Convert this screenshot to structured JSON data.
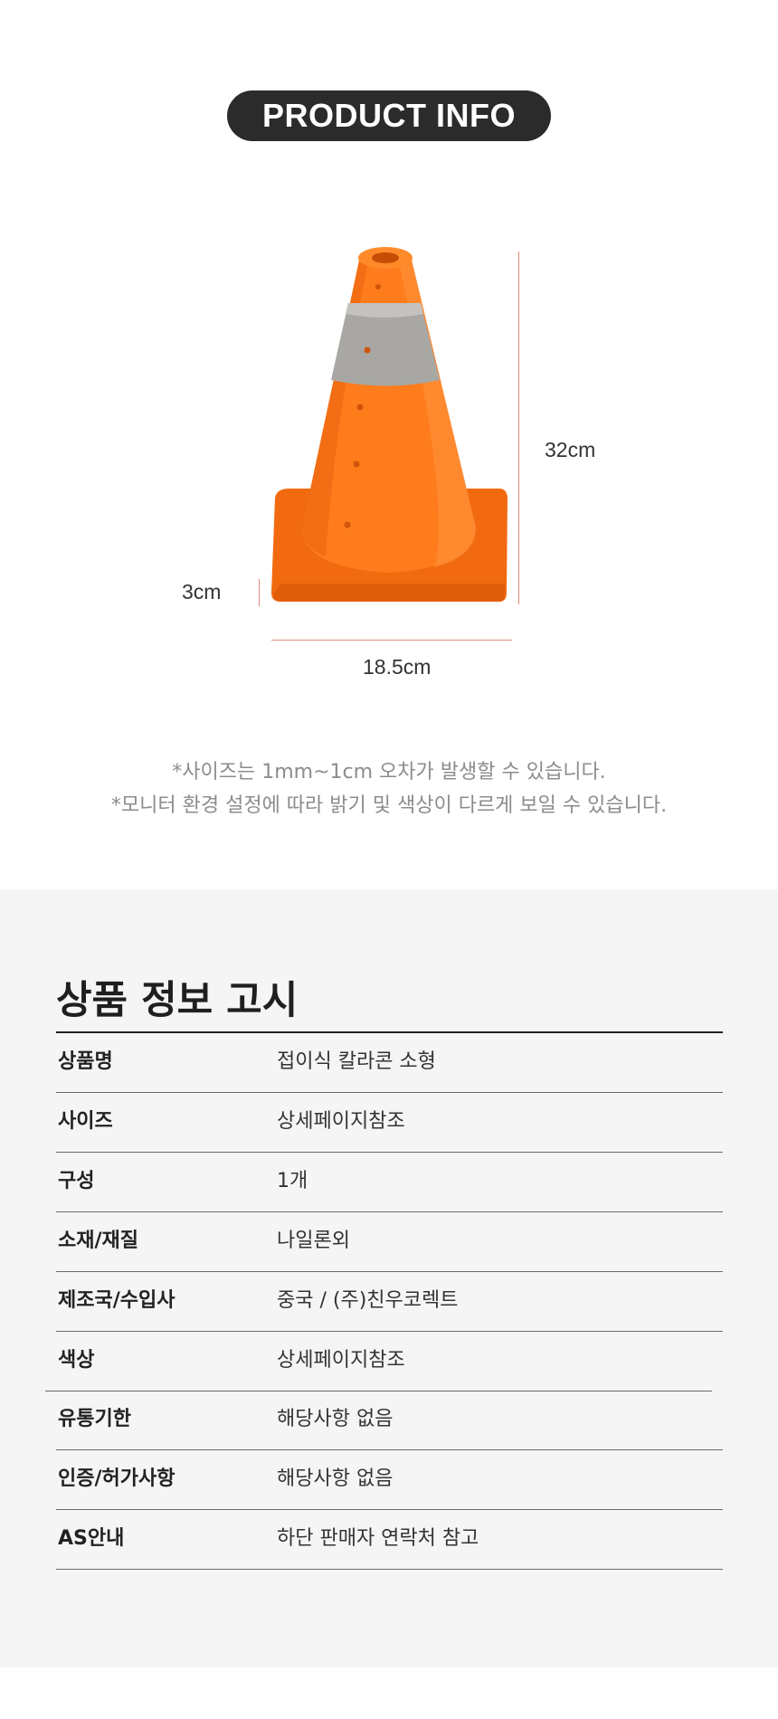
{
  "header": {
    "badge_label": "PRODUCT INFO"
  },
  "product_image": {
    "alt": "orange collapsible traffic cone",
    "dimensions": {
      "height": "32cm",
      "base_width": "18.5cm",
      "base_height": "3cm"
    },
    "colors": {
      "cone": "#ff7a1a",
      "reflective_band": "#a9a7a3",
      "dimension_line": "#e58a7e"
    }
  },
  "notes": [
    "*사이즈는 1mm~1cm 오차가 발생할 수 있습니다.",
    "*모니터 환경 설정에 따라 밝기 및 색상이 다르게 보일 수 있습니다."
  ],
  "notice": {
    "title": "상품 정보 고시",
    "rows": [
      {
        "key": "상품명",
        "value": "접이식 칼라콘 소형"
      },
      {
        "key": "사이즈",
        "value": "상세페이지참조"
      },
      {
        "key": "구성",
        "value": "1개"
      },
      {
        "key": "소재/재질",
        "value": "나일론외"
      },
      {
        "key": "제조국/수입사",
        "value": "중국 / (주)친우코렉트"
      },
      {
        "key": "색상",
        "value": "상세페이지참조"
      },
      {
        "key": "유통기한",
        "value": "해당사항 없음"
      },
      {
        "key": "인증/허가사항",
        "value": "해당사항 없음"
      },
      {
        "key": "AS안내",
        "value": "하단 판매자 연락처 참고"
      }
    ]
  }
}
